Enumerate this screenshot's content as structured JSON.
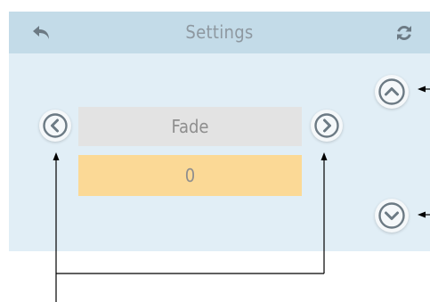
{
  "header": {
    "title": "Settings",
    "back_icon": "undo-arrow-icon",
    "refresh_icon": "refresh-icon"
  },
  "selector": {
    "label": "Fade",
    "value": "0",
    "prev_icon": "chevron-left-icon",
    "next_icon": "chevron-right-icon"
  },
  "side_controls": {
    "up_icon": "chevron-up-icon",
    "down_icon": "chevron-down-icon"
  },
  "colors": {
    "header_bg": "#c3dbe8",
    "panel_bg": "#e1eef6",
    "label_bg": "#e3e3e3",
    "value_bg": "#fbd996",
    "icon": "#6c7a84"
  }
}
